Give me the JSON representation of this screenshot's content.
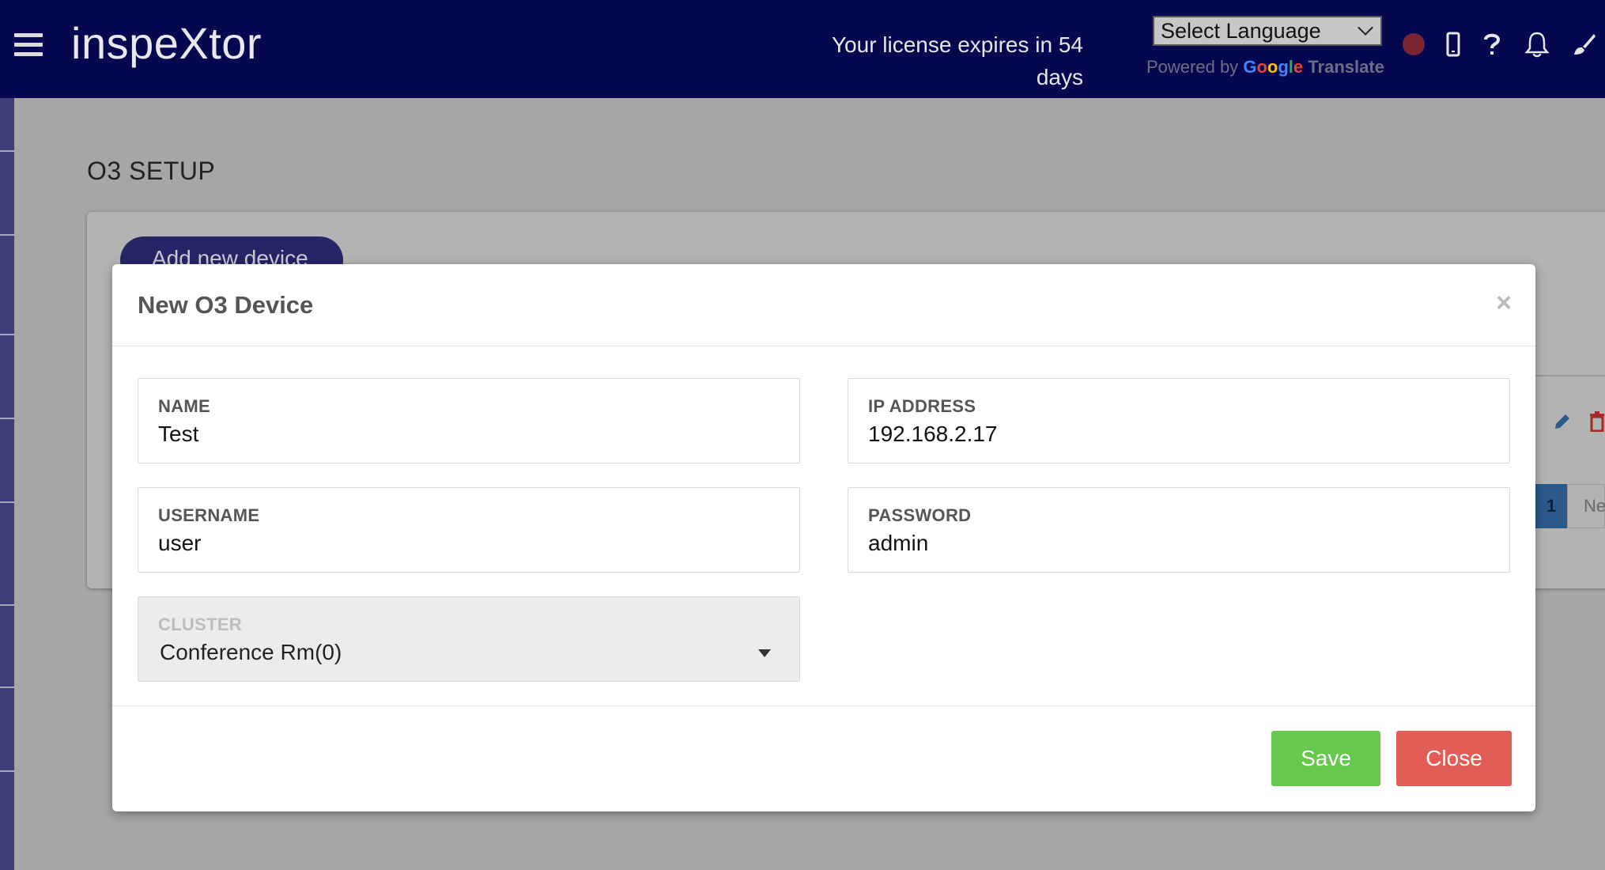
{
  "header": {
    "app_title": "inspeXtor",
    "license_text": "Your license expires in 54 days",
    "language_select": "Select Language",
    "powered_by": "Powered by",
    "google_letters": [
      "G",
      "o",
      "o",
      "g",
      "l",
      "e"
    ],
    "translate": "Translate",
    "status_color": "#7a2534",
    "icons": [
      "menu-icon",
      "mobile-icon",
      "help-icon",
      "bell-icon",
      "brush-icon"
    ]
  },
  "page": {
    "title": "O3 SETUP",
    "add_button": "Add new device",
    "pagination": {
      "current": "1",
      "next": "Ne"
    }
  },
  "modal": {
    "title": "New O3 Device",
    "close_symbol": "×",
    "fields": {
      "name": {
        "label": "NAME",
        "value": "Test"
      },
      "ip": {
        "label": "IP ADDRESS",
        "value": "192.168.2.17"
      },
      "username": {
        "label": "USERNAME",
        "value": "user"
      },
      "password": {
        "label": "PASSWORD",
        "value": "admin"
      },
      "cluster": {
        "label": "CLUSTER",
        "value": "Conference Rm(0)"
      }
    },
    "buttons": {
      "save": "Save",
      "close": "Close"
    },
    "colors": {
      "save": "#66c84c",
      "close": "#e25d56"
    }
  }
}
